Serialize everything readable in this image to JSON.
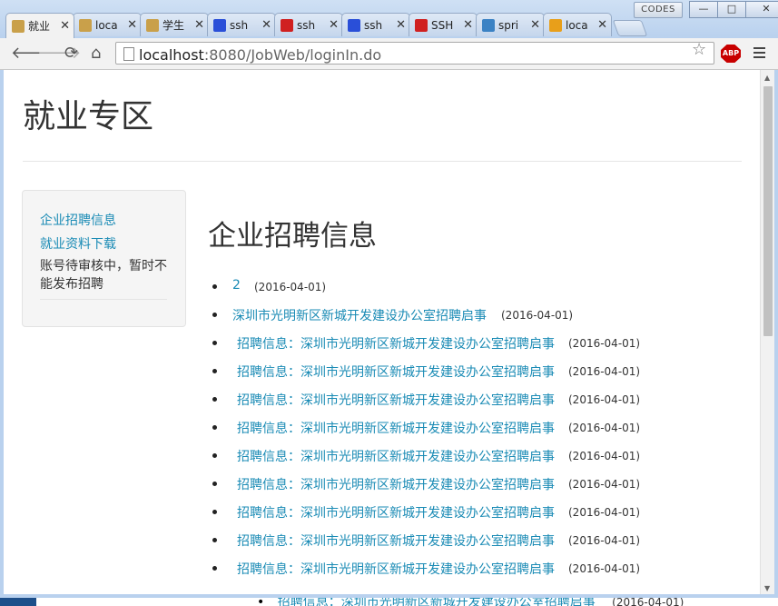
{
  "browser": {
    "tabs": [
      {
        "label": "就业",
        "icon": "page-icon",
        "color": "#c9a04a",
        "active": true
      },
      {
        "label": "loca",
        "icon": "page-icon",
        "color": "#c9a04a"
      },
      {
        "label": "学生",
        "icon": "page-icon",
        "color": "#c9a04a"
      },
      {
        "label": "ssh",
        "icon": "baidu-paw-icon",
        "color": "#2a4fd8"
      },
      {
        "label": "ssh",
        "icon": "csdn-c-icon",
        "color": "#d02020"
      },
      {
        "label": "ssh",
        "icon": "baidu-paw-icon",
        "color": "#2a4fd8"
      },
      {
        "label": "SSH",
        "icon": "csdn-c-icon",
        "color": "#d02020"
      },
      {
        "label": "spri",
        "icon": "spring-icon",
        "color": "#3b82c4"
      },
      {
        "label": "loca",
        "icon": "pma-icon",
        "color": "#e89f1a"
      }
    ],
    "codes_label": "CODES",
    "url_host": "localhost",
    "url_rest": ":8080/JobWeb/loginIn.do",
    "abp_label": "ABP"
  },
  "page": {
    "title": "就业专区",
    "sidebar": {
      "links": [
        "企业招聘信息",
        "就业资料下载"
      ],
      "note": "账号待审核中，暂时不能发布招聘"
    },
    "section_title": "企业招聘信息",
    "jobs": [
      {
        "title": "2",
        "date": "(2016-04-01)"
      },
      {
        "title": "深圳市光明新区新城开发建设办公室招聘启事",
        "date": "(2016-04-01)"
      },
      {
        "title": "招聘信息：深圳市光明新区新城开发建设办公室招聘启事",
        "date": "(2016-04-01)"
      },
      {
        "title": "招聘信息：深圳市光明新区新城开发建设办公室招聘启事",
        "date": "(2016-04-01)"
      },
      {
        "title": "招聘信息：深圳市光明新区新城开发建设办公室招聘启事",
        "date": "(2016-04-01)"
      },
      {
        "title": "招聘信息：深圳市光明新区新城开发建设办公室招聘启事",
        "date": "(2016-04-01)"
      },
      {
        "title": "招聘信息：深圳市光明新区新城开发建设办公室招聘启事",
        "date": "(2016-04-01)"
      },
      {
        "title": "招聘信息：深圳市光明新区新城开发建设办公室招聘启事",
        "date": "(2016-04-01)"
      },
      {
        "title": "招聘信息：深圳市光明新区新城开发建设办公室招聘启事",
        "date": "(2016-04-01)"
      },
      {
        "title": "招聘信息：深圳市光明新区新城开发建设办公室招聘启事",
        "date": "(2016-04-01)"
      },
      {
        "title": "招聘信息：深圳市光明新区新城开发建设办公室招聘启事",
        "date": "(2016-04-01)"
      }
    ],
    "overflow_job": {
      "title": "招聘信息：深圳市光明新区新城开发建设办公室招聘启事",
      "date": "(2016-04-01)"
    }
  }
}
